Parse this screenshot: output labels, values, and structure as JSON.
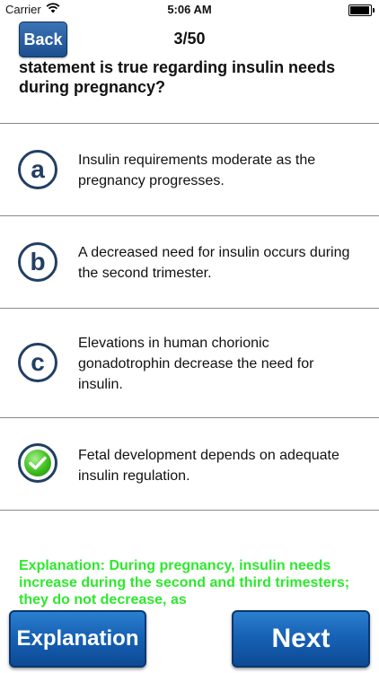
{
  "status": {
    "carrier": "Carrier",
    "time": "5:06 AM"
  },
  "nav": {
    "back_label": "Back",
    "counter": "3/50"
  },
  "question": {
    "text": "statement is true regarding insulin needs during pregnancy?"
  },
  "options": [
    {
      "letter": "a",
      "text": "Insulin requirements moderate as the pregnancy progresses."
    },
    {
      "letter": "b",
      "text": "A decreased need for insulin occurs during the second trimester."
    },
    {
      "letter": "c",
      "text": "Elevations in human chorionic gonadotrophin decrease the need for insulin."
    },
    {
      "letter": "",
      "text": "Fetal development depends on adequate insulin regulation.",
      "icon": "green-check-icon"
    }
  ],
  "explanation": {
    "text": "Explanation: During pregnancy, insulin needs increase during the second and third trimesters; they do not decrease, as"
  },
  "buttons": {
    "explanation_label": "Explanation",
    "next_label": "Next"
  },
  "colors": {
    "accent_blue": "#1762b5",
    "explanation_green": "#2ee82e",
    "icon_navy": "#213f63"
  }
}
